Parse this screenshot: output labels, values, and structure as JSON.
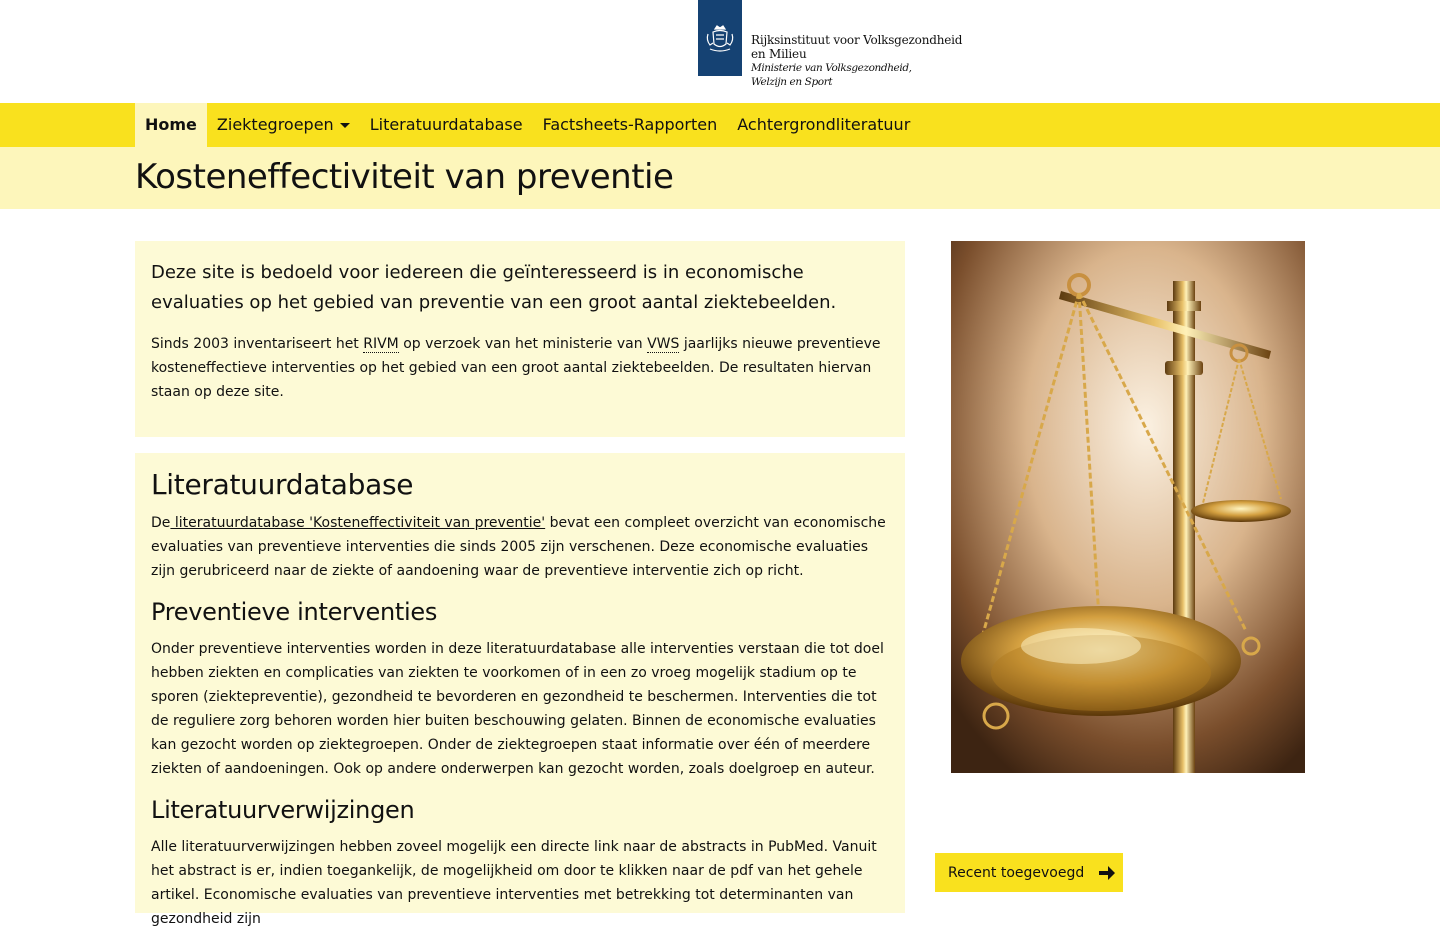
{
  "header": {
    "logo_lines": [
      "Rijksinstituut voor Volksgezondheid",
      "en Milieu",
      "Ministerie van Volksgezondheid,",
      "Welzijn en Sport"
    ]
  },
  "nav": {
    "items": [
      {
        "label": "Home",
        "active": true
      },
      {
        "label": "Ziektegroepen",
        "has_dropdown": true
      },
      {
        "label": "Literatuurdatabase"
      },
      {
        "label": "Factsheets-Rapporten"
      },
      {
        "label": "Achtergrondliteratuur"
      }
    ]
  },
  "page": {
    "title": "Kosteneffectiviteit van preventie"
  },
  "intro": {
    "lead": "Deze site is bedoeld voor iedereen die geïnteresseerd is in economische evaluaties op het gebied van preventie van een groot aantal ziektebeelden.",
    "p_part1": "Sinds 2003 inventariseert het ",
    "abbr_rivm": "RIVM",
    "p_part2": " op verzoek van het ministerie van ",
    "abbr_vws": "VWS",
    "p_part3": " jaarlijks nieuwe preventieve kosteneffectieve interventies op het gebied van een groot aantal ziektebeelden. De resultaten hiervan staan op deze site."
  },
  "literatuurdatabase": {
    "heading": "Literatuurdatabase",
    "p_prefix": "De",
    "link_text": " literatuurdatabase 'Kosteneffectiviteit van preventie'",
    "p_suffix": " bevat een compleet overzicht van economische evaluaties van preventieve interventies die sinds 2005 zijn verschenen. Deze economische evaluaties zijn gerubriceerd naar de ziekte of aandoening waar de preventieve interventie zich op richt."
  },
  "preventieve": {
    "heading": "Preventieve interventies",
    "text": "Onder preventieve interventies worden in deze literatuurdatabase alle interventies verstaan die tot doel hebben ziekten en complicaties van ziekten te voorkomen of in een zo vroeg mogelijk stadium op te sporen (ziektepreventie), gezondheid te bevorderen en gezondheid te beschermen. Interventies die tot de reguliere zorg behoren worden hier buiten beschouwing gelaten. Binnen de economische evaluaties kan gezocht worden op ziektegroepen. Onder de ziektegroepen staat informatie over één of meerdere ziekten of aandoeningen. Ook op andere onderwerpen kan gezocht worden, zoals doelgroep en auteur."
  },
  "verwijzingen": {
    "heading": "Literatuurverwijzingen",
    "text": "Alle literatuurverwijzingen hebben zoveel mogelijk een directe link naar de abstracts in PubMed. Vanuit het abstract is er, indien toegankelijk, de mogelijkheid om door te klikken naar de pdf van het gehele artikel. Economische evaluaties van preventieve interventies met betrekking tot determinanten van gezondheid zijn"
  },
  "sidebar": {
    "recent_label": "Recent toegevoegd",
    "image_icon": "balance-scale-image"
  },
  "colors": {
    "brand_yellow": "#f9e11e",
    "light_yellow": "#fdf6bb",
    "panel_bg": "#fdfad6",
    "logo_blue": "#154273"
  }
}
